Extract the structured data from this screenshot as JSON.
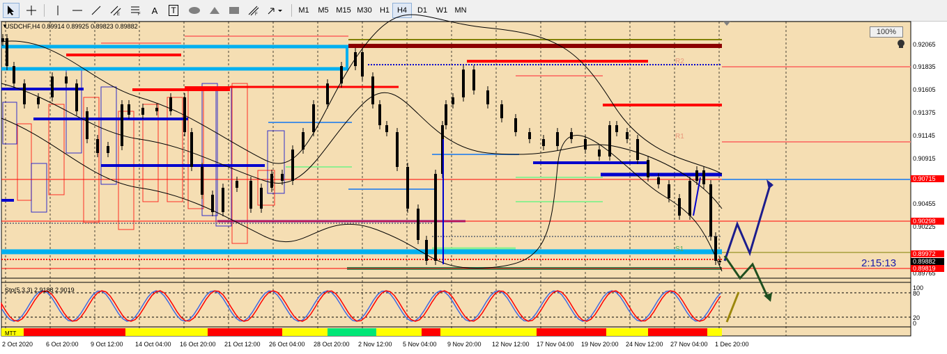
{
  "toolbar": {
    "timeframes": [
      "M1",
      "M5",
      "M15",
      "M30",
      "H1",
      "H4",
      "D1",
      "W1",
      "MN"
    ],
    "selected_timeframe": "H4",
    "text_tool_label": "A",
    "text_label_tool_label": "T"
  },
  "chart": {
    "symbol_info": "USDCHF,H4  0.89914 0.89925 0.89823 0.89882",
    "zoom_label": "100%",
    "countdown": "2:15:13",
    "indicator_label": "Sto(5,3,3) 2.9188 2.9019",
    "mtt_label": "MTT",
    "pivot_labels": [
      "R2",
      "R1",
      "S1"
    ],
    "price_labels": [
      "0.92065",
      "0.91835",
      "0.91605",
      "0.91375",
      "0.91145",
      "0.90915",
      "0.90455",
      "0.90225",
      "0.89765"
    ],
    "price_tags": [
      {
        "text": "0.90715",
        "color": "#ff0000"
      },
      {
        "text": "0.90298",
        "color": "#ff0000"
      },
      {
        "text": "0.89972",
        "color": "#ff0000"
      },
      {
        "text": "0.89882",
        "color": "#000000"
      },
      {
        "text": "0.89819",
        "color": "#ff0000"
      }
    ],
    "osc_levels": [
      "100",
      "80",
      "20",
      "0"
    ],
    "date_labels": [
      "2 Oct 2020",
      "6 Oct 20:00",
      "9 Oct 12:00",
      "14 Oct 04:00",
      "16 Oct 20:00",
      "21 Oct 12:00",
      "26 Oct 04:00",
      "28 Oct 20:00",
      "2 Nov 12:00",
      "5 Nov 04:00",
      "9 Nov 20:00",
      "12 Nov 12:00",
      "17 Nov 04:00",
      "19 Nov 20:00",
      "24 Nov 12:00",
      "27 Nov 04:00",
      "1 Dec 20:00"
    ],
    "colors": {
      "background": "#f5deb3",
      "bull": "#000000",
      "bear": "#000000",
      "resistance": "#ff0000",
      "support": "#0000cd",
      "cyan": "#00b0f0"
    }
  }
}
